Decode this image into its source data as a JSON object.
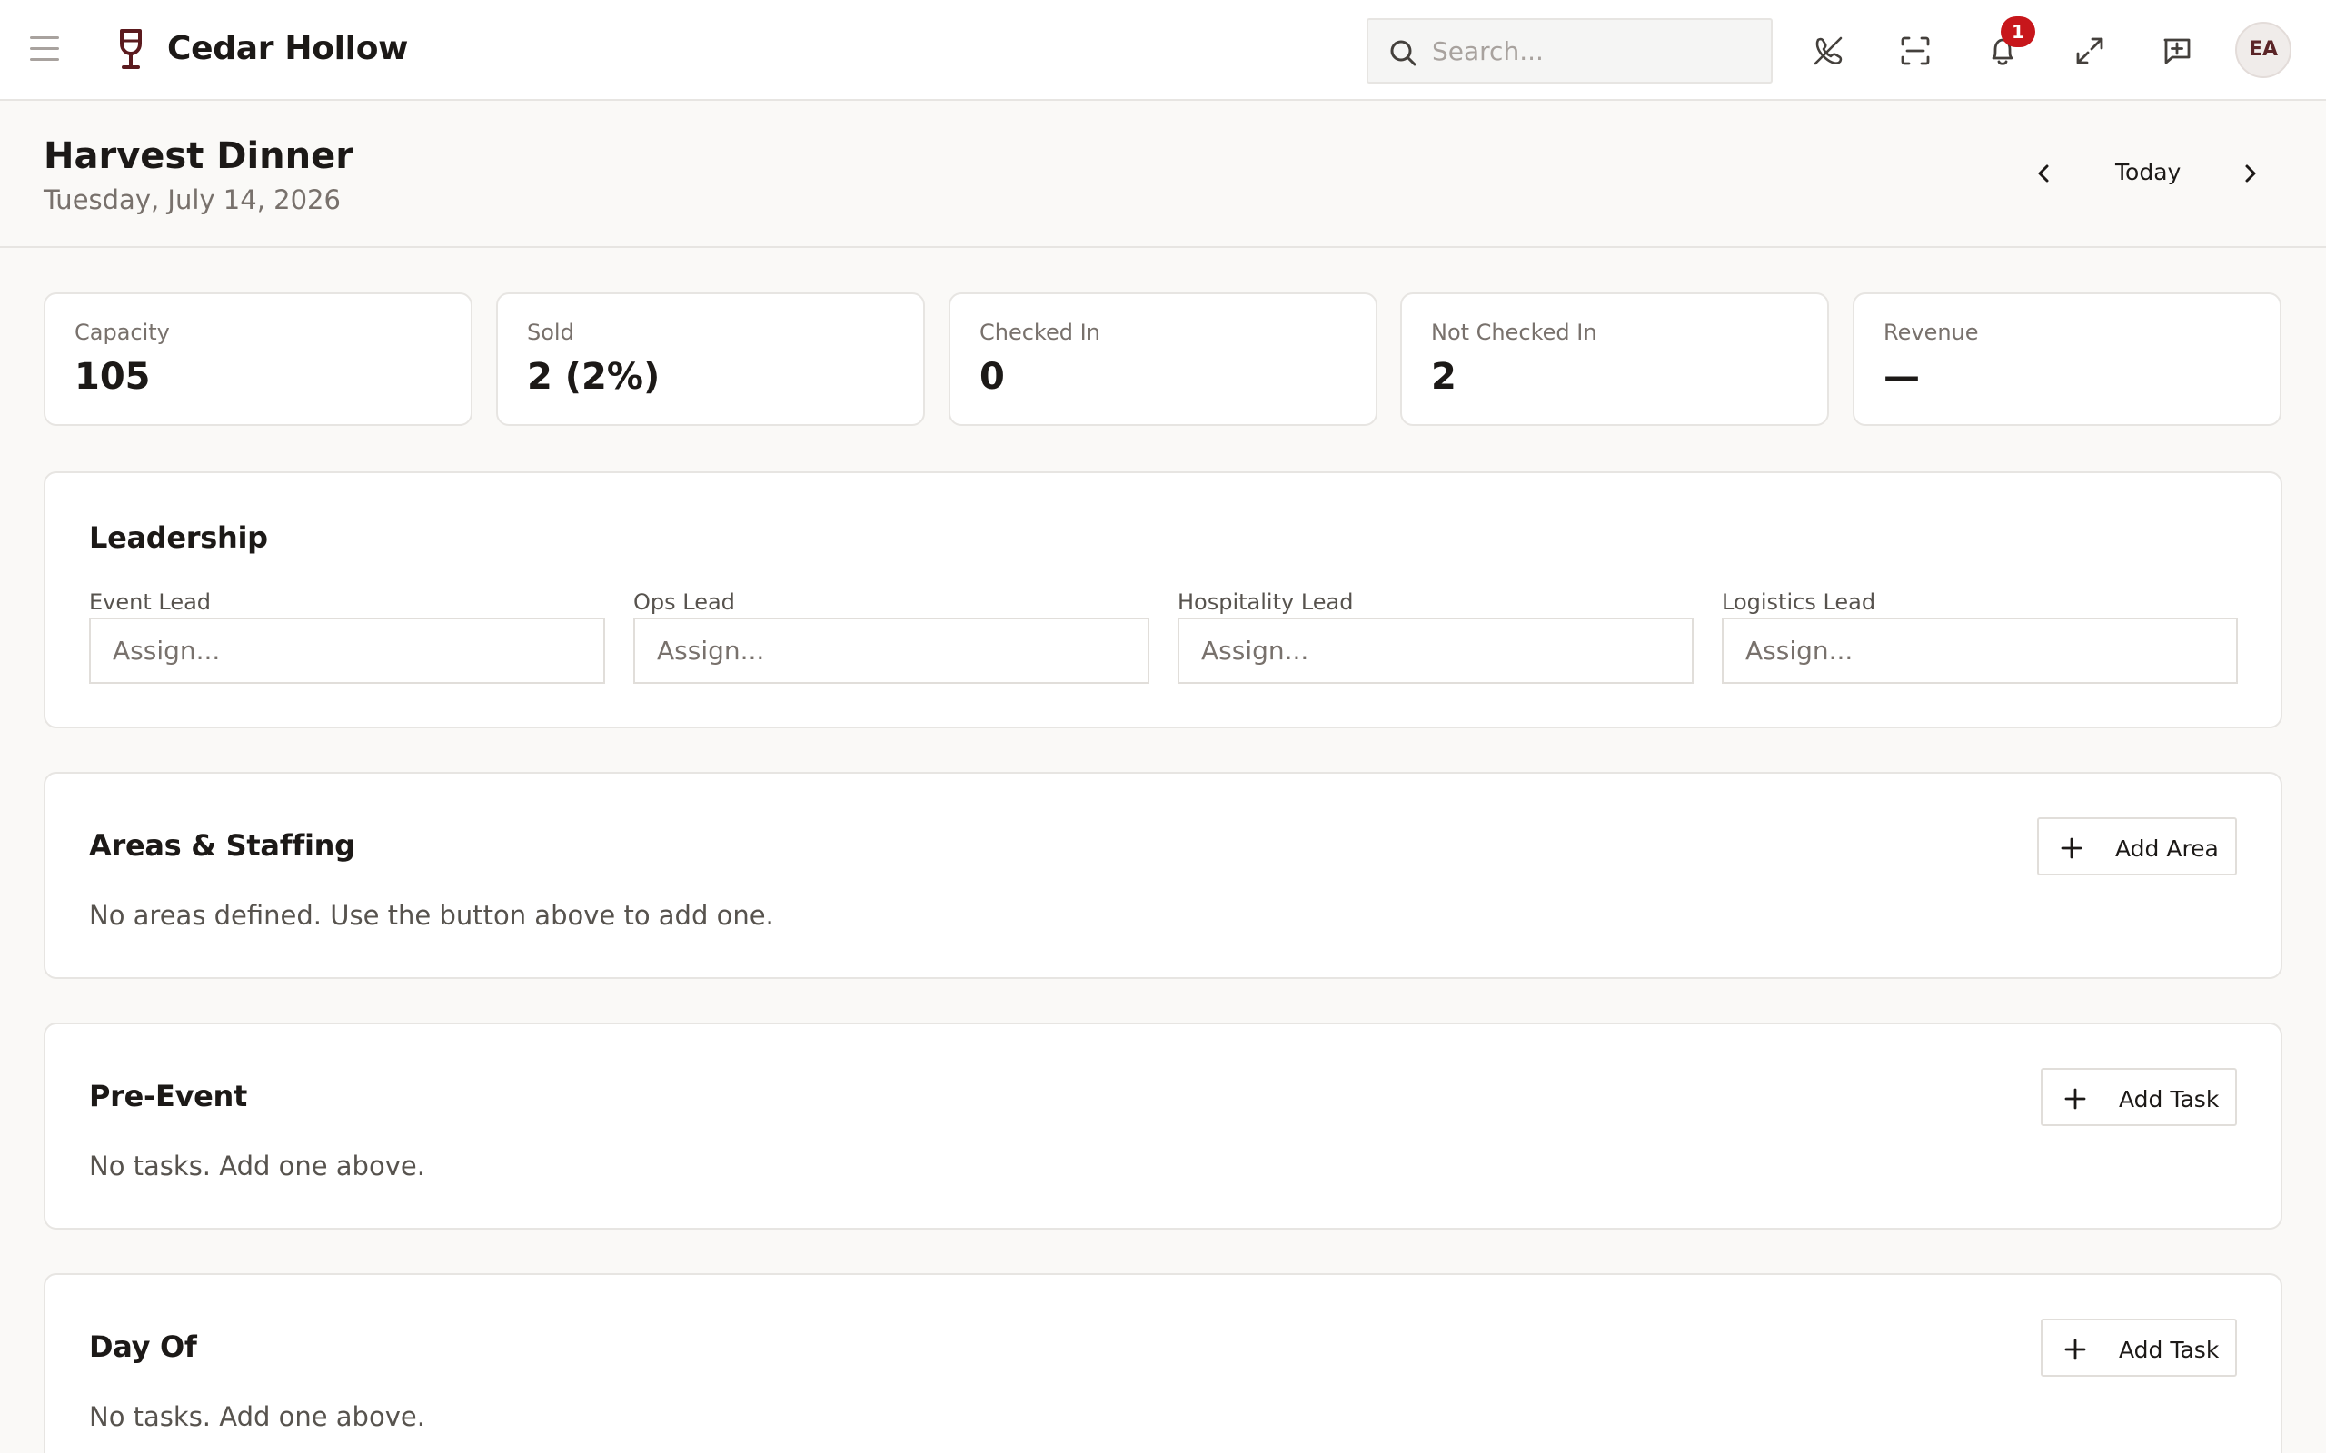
{
  "app": {
    "name": "Cedar Hollow",
    "search_placeholder": "Search...",
    "notification_count": "1",
    "user_initials": "EA",
    "brand_color": "#5b1a1e",
    "alert_color": "#c7161b"
  },
  "header": {
    "title": "Harvest Dinner",
    "date": "Tuesday, July 14, 2026",
    "today_label": "Today"
  },
  "stats": [
    {
      "label": "Capacity",
      "value": "105"
    },
    {
      "label": "Sold",
      "value": "2 (2%)"
    },
    {
      "label": "Checked In",
      "value": "0"
    },
    {
      "label": "Not Checked In",
      "value": "2"
    },
    {
      "label": "Revenue",
      "value": "—"
    }
  ],
  "leadership": {
    "title": "Leadership",
    "leads": [
      {
        "label": "Event Lead",
        "placeholder": "Assign..."
      },
      {
        "label": "Ops Lead",
        "placeholder": "Assign..."
      },
      {
        "label": "Hospitality Lead",
        "placeholder": "Assign..."
      },
      {
        "label": "Logistics Lead",
        "placeholder": "Assign..."
      }
    ]
  },
  "areas": {
    "title": "Areas & Staffing",
    "button_label": "Add Area",
    "empty_text": "No areas defined. Use the button above to add one."
  },
  "pre_event": {
    "title": "Pre-Event",
    "button_label": "Add Task",
    "empty_text": "No tasks. Add one above."
  },
  "day_of": {
    "title": "Day Of",
    "button_label": "Add Task",
    "empty_text": "No tasks. Add one above."
  }
}
